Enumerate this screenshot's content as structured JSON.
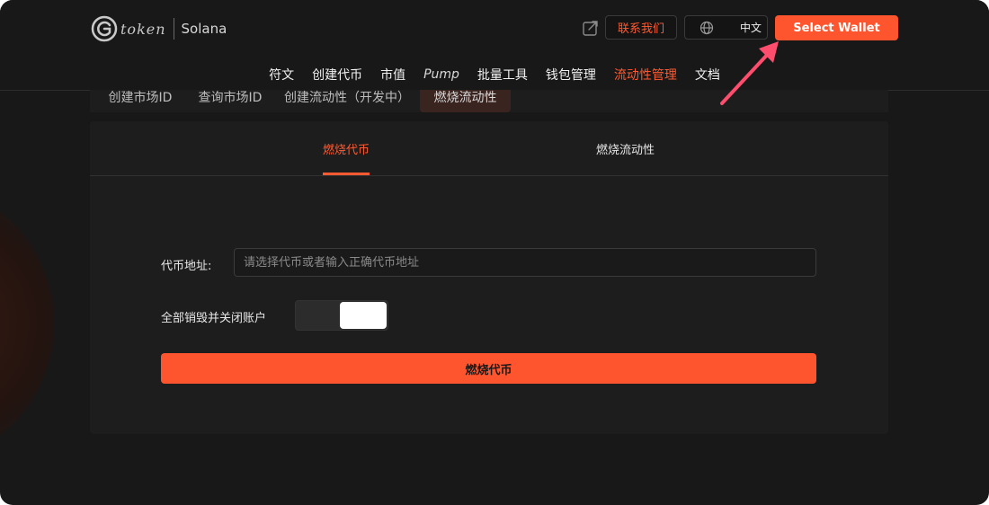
{
  "header": {
    "logo_text": "token",
    "chain": "Solana",
    "contact_label": "联系我们",
    "language_label": "中文",
    "wallet_label": "Select Wallet"
  },
  "nav": {
    "items": [
      {
        "label": "符文"
      },
      {
        "label": "创建代币"
      },
      {
        "label": "市值"
      },
      {
        "label": "Pump"
      },
      {
        "label": "批量工具"
      },
      {
        "label": "钱包管理"
      },
      {
        "label": "流动性管理"
      },
      {
        "label": "文档"
      }
    ],
    "active": "流动性管理"
  },
  "subtabs": {
    "items": [
      {
        "label": "创建市场ID"
      },
      {
        "label": "查询市场ID"
      },
      {
        "label": "创建流动性（开发中）"
      },
      {
        "label": "燃烧流动性"
      }
    ],
    "active": "燃烧流动性"
  },
  "card": {
    "tabs": [
      {
        "label": "燃烧代币"
      },
      {
        "label": "燃烧流动性"
      }
    ],
    "active_tab": "燃烧代币",
    "address_label": "代币地址:",
    "address_placeholder": "请选择代币或者输入正确代币地址",
    "address_value": "",
    "burn_all_label": "全部销毁并关闭账户",
    "burn_all_enabled": true,
    "submit_label": "燃烧代币"
  },
  "colors": {
    "accent": "#ff552e",
    "background": "#181818",
    "panel": "#1d1d1d",
    "annotation_arrow": "#ff4d6d"
  },
  "icons": {
    "share": "share-icon",
    "language": "globe-icon",
    "logo": "token-logo-icon",
    "annotation": "annotation-arrow-icon"
  }
}
